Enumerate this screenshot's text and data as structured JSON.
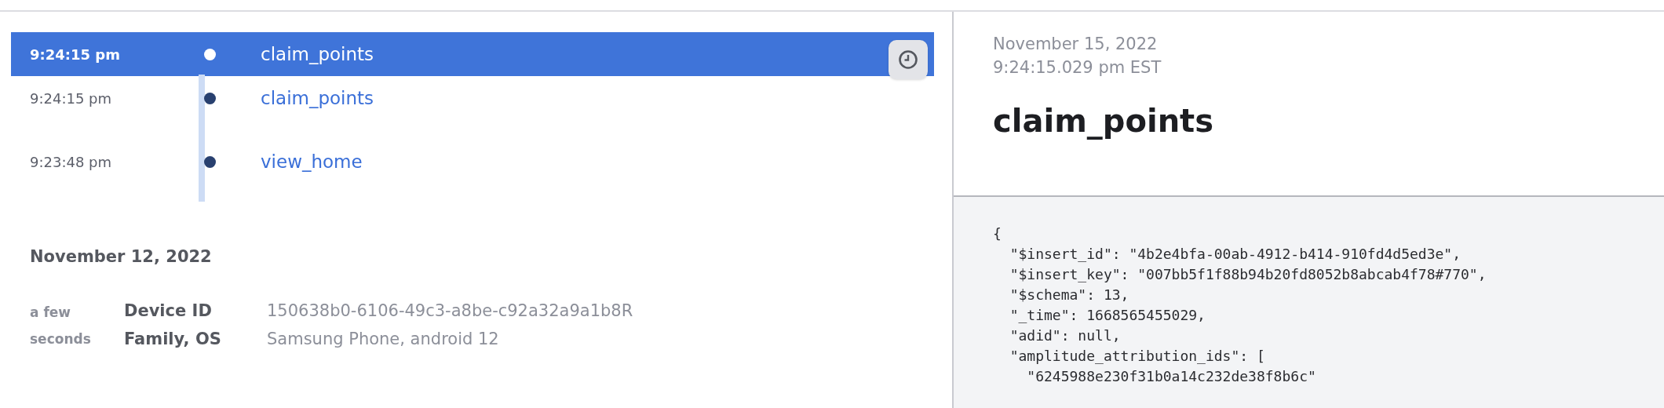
{
  "events": [
    {
      "time": "9:24:15 pm",
      "name": "claim_points",
      "selected": true
    },
    {
      "time": "9:24:15 pm",
      "name": "claim_points",
      "selected": false
    },
    {
      "time": "9:23:48 pm",
      "name": "view_home",
      "selected": false
    }
  ],
  "session": {
    "date": "November 12, 2022",
    "ago": "a few seconds",
    "properties": [
      {
        "label": "Device ID",
        "value": "150638b0-6106-49c3-a8be-c92a32a9a1b8R"
      },
      {
        "label": "Family, OS",
        "value": "Samsung Phone, android 12"
      }
    ]
  },
  "detail": {
    "date": "November 15, 2022",
    "time": "9:24:15.029 pm EST",
    "title": "claim_points",
    "code_lines": [
      "{",
      "  \"$insert_id\": \"4b2e4bfa-00ab-4912-b414-910fd4d5ed3e\",",
      "  \"$insert_key\": \"007bb5f1f88b94b20fd8052b8abcab4f78#770\",",
      "  \"$schema\": 13,",
      "  \"_time\": 1668565455029,",
      "  \"adid\": null,",
      "  \"amplitude_attribution_ids\": [",
      "    \"6245988e230f31b0a14c232de38f8b6c\""
    ]
  }
}
